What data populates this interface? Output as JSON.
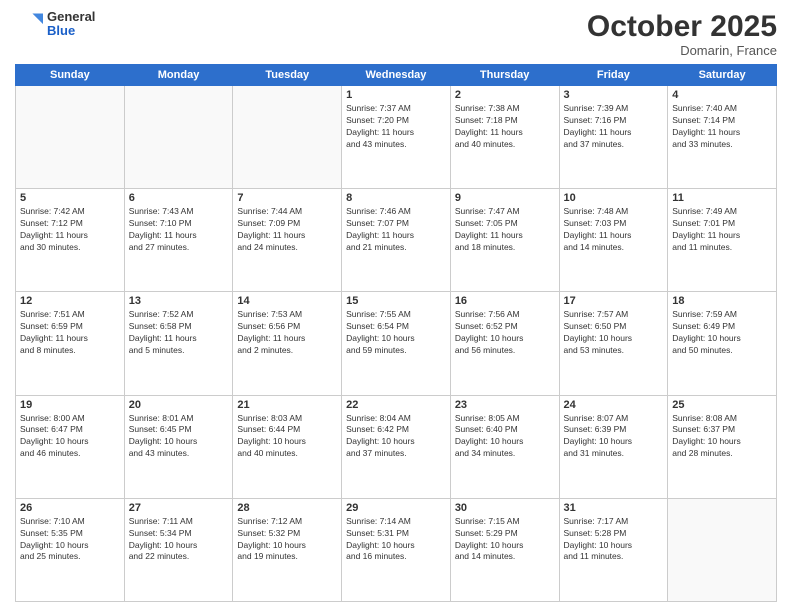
{
  "header": {
    "logo_general": "General",
    "logo_blue": "Blue",
    "month": "October 2025",
    "location": "Domarin, France"
  },
  "weekdays": [
    "Sunday",
    "Monday",
    "Tuesday",
    "Wednesday",
    "Thursday",
    "Friday",
    "Saturday"
  ],
  "weeks": [
    [
      {
        "day": "",
        "info": ""
      },
      {
        "day": "",
        "info": ""
      },
      {
        "day": "",
        "info": ""
      },
      {
        "day": "1",
        "info": "Sunrise: 7:37 AM\nSunset: 7:20 PM\nDaylight: 11 hours\nand 43 minutes."
      },
      {
        "day": "2",
        "info": "Sunrise: 7:38 AM\nSunset: 7:18 PM\nDaylight: 11 hours\nand 40 minutes."
      },
      {
        "day": "3",
        "info": "Sunrise: 7:39 AM\nSunset: 7:16 PM\nDaylight: 11 hours\nand 37 minutes."
      },
      {
        "day": "4",
        "info": "Sunrise: 7:40 AM\nSunset: 7:14 PM\nDaylight: 11 hours\nand 33 minutes."
      }
    ],
    [
      {
        "day": "5",
        "info": "Sunrise: 7:42 AM\nSunset: 7:12 PM\nDaylight: 11 hours\nand 30 minutes."
      },
      {
        "day": "6",
        "info": "Sunrise: 7:43 AM\nSunset: 7:10 PM\nDaylight: 11 hours\nand 27 minutes."
      },
      {
        "day": "7",
        "info": "Sunrise: 7:44 AM\nSunset: 7:09 PM\nDaylight: 11 hours\nand 24 minutes."
      },
      {
        "day": "8",
        "info": "Sunrise: 7:46 AM\nSunset: 7:07 PM\nDaylight: 11 hours\nand 21 minutes."
      },
      {
        "day": "9",
        "info": "Sunrise: 7:47 AM\nSunset: 7:05 PM\nDaylight: 11 hours\nand 18 minutes."
      },
      {
        "day": "10",
        "info": "Sunrise: 7:48 AM\nSunset: 7:03 PM\nDaylight: 11 hours\nand 14 minutes."
      },
      {
        "day": "11",
        "info": "Sunrise: 7:49 AM\nSunset: 7:01 PM\nDaylight: 11 hours\nand 11 minutes."
      }
    ],
    [
      {
        "day": "12",
        "info": "Sunrise: 7:51 AM\nSunset: 6:59 PM\nDaylight: 11 hours\nand 8 minutes."
      },
      {
        "day": "13",
        "info": "Sunrise: 7:52 AM\nSunset: 6:58 PM\nDaylight: 11 hours\nand 5 minutes."
      },
      {
        "day": "14",
        "info": "Sunrise: 7:53 AM\nSunset: 6:56 PM\nDaylight: 11 hours\nand 2 minutes."
      },
      {
        "day": "15",
        "info": "Sunrise: 7:55 AM\nSunset: 6:54 PM\nDaylight: 10 hours\nand 59 minutes."
      },
      {
        "day": "16",
        "info": "Sunrise: 7:56 AM\nSunset: 6:52 PM\nDaylight: 10 hours\nand 56 minutes."
      },
      {
        "day": "17",
        "info": "Sunrise: 7:57 AM\nSunset: 6:50 PM\nDaylight: 10 hours\nand 53 minutes."
      },
      {
        "day": "18",
        "info": "Sunrise: 7:59 AM\nSunset: 6:49 PM\nDaylight: 10 hours\nand 50 minutes."
      }
    ],
    [
      {
        "day": "19",
        "info": "Sunrise: 8:00 AM\nSunset: 6:47 PM\nDaylight: 10 hours\nand 46 minutes."
      },
      {
        "day": "20",
        "info": "Sunrise: 8:01 AM\nSunset: 6:45 PM\nDaylight: 10 hours\nand 43 minutes."
      },
      {
        "day": "21",
        "info": "Sunrise: 8:03 AM\nSunset: 6:44 PM\nDaylight: 10 hours\nand 40 minutes."
      },
      {
        "day": "22",
        "info": "Sunrise: 8:04 AM\nSunset: 6:42 PM\nDaylight: 10 hours\nand 37 minutes."
      },
      {
        "day": "23",
        "info": "Sunrise: 8:05 AM\nSunset: 6:40 PM\nDaylight: 10 hours\nand 34 minutes."
      },
      {
        "day": "24",
        "info": "Sunrise: 8:07 AM\nSunset: 6:39 PM\nDaylight: 10 hours\nand 31 minutes."
      },
      {
        "day": "25",
        "info": "Sunrise: 8:08 AM\nSunset: 6:37 PM\nDaylight: 10 hours\nand 28 minutes."
      }
    ],
    [
      {
        "day": "26",
        "info": "Sunrise: 7:10 AM\nSunset: 5:35 PM\nDaylight: 10 hours\nand 25 minutes."
      },
      {
        "day": "27",
        "info": "Sunrise: 7:11 AM\nSunset: 5:34 PM\nDaylight: 10 hours\nand 22 minutes."
      },
      {
        "day": "28",
        "info": "Sunrise: 7:12 AM\nSunset: 5:32 PM\nDaylight: 10 hours\nand 19 minutes."
      },
      {
        "day": "29",
        "info": "Sunrise: 7:14 AM\nSunset: 5:31 PM\nDaylight: 10 hours\nand 16 minutes."
      },
      {
        "day": "30",
        "info": "Sunrise: 7:15 AM\nSunset: 5:29 PM\nDaylight: 10 hours\nand 14 minutes."
      },
      {
        "day": "31",
        "info": "Sunrise: 7:17 AM\nSunset: 5:28 PM\nDaylight: 10 hours\nand 11 minutes."
      },
      {
        "day": "",
        "info": ""
      }
    ]
  ]
}
